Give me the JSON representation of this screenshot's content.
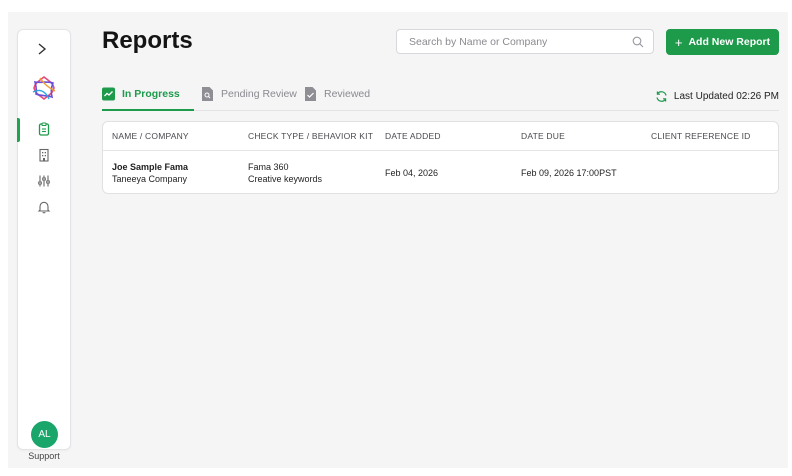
{
  "sidebar": {
    "expand_icon": "chevron-right-icon",
    "nav": [
      {
        "name": "reports",
        "icon": "clipboard-icon",
        "active": true
      },
      {
        "name": "companies",
        "icon": "building-icon",
        "active": false
      },
      {
        "name": "settings",
        "icon": "sliders-icon",
        "active": false
      },
      {
        "name": "notifications",
        "icon": "bell-icon",
        "active": false
      }
    ],
    "avatar_initials": "AL",
    "support_label": "Support"
  },
  "header": {
    "title": "Reports",
    "search_placeholder": "Search by Name or Company",
    "add_button_label": "Add New Report"
  },
  "tabs": [
    {
      "label": "In Progress",
      "active": true,
      "icon": "trend-icon"
    },
    {
      "label": "Pending Review",
      "active": false,
      "icon": "document-search-icon"
    },
    {
      "label": "Reviewed",
      "active": false,
      "icon": "document-check-icon"
    }
  ],
  "last_updated": "Last Updated 02:26 PM",
  "table": {
    "columns": [
      "NAME / COMPANY",
      "CHECK TYPE / BEHAVIOR KIT",
      "DATE ADDED",
      "DATE DUE",
      "CLIENT REFERENCE ID"
    ],
    "rows": [
      {
        "name": "Joe Sample Fama",
        "company": "Taneeya Company",
        "check_type": "Fama 360",
        "behavior_kit": "Creative keywords",
        "date_added": "Feb 04, 2026",
        "date_due": "Feb 09, 2026 17:00PST",
        "client_reference_id": ""
      }
    ]
  },
  "colors": {
    "accent": "#1d9a4a",
    "avatar": "#1aa56b",
    "background": "#f5f5f6"
  }
}
